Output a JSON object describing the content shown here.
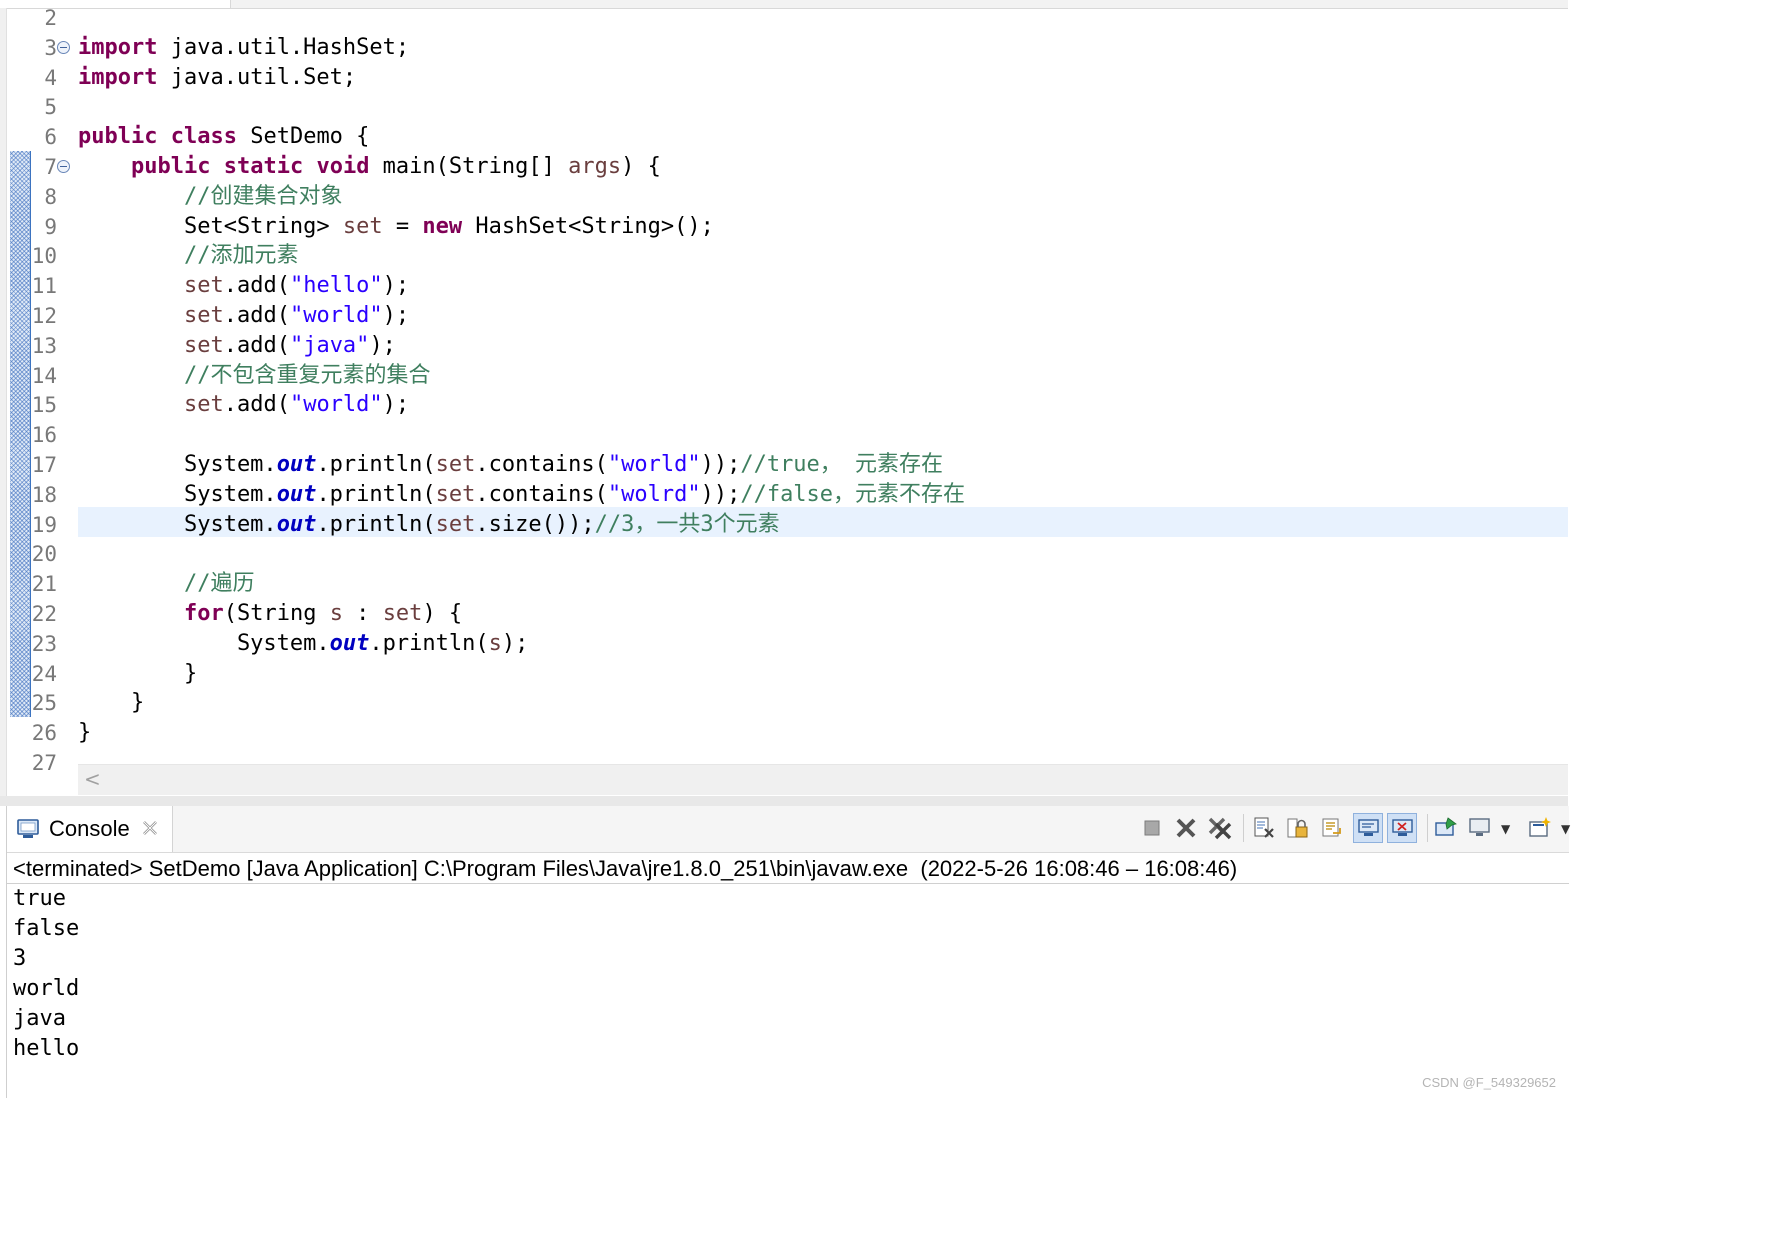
{
  "editor": {
    "current_line": "19",
    "lines": [
      {
        "no": "2",
        "fold": false,
        "tokens": []
      },
      {
        "no": "3",
        "fold": true,
        "tokens": [
          {
            "t": "kw",
            "v": "import"
          },
          {
            "t": "plain",
            "v": " java.util.HashSet;"
          }
        ]
      },
      {
        "no": "4",
        "fold": false,
        "tokens": [
          {
            "t": "kw",
            "v": "import"
          },
          {
            "t": "plain",
            "v": " java.util.Set;"
          }
        ]
      },
      {
        "no": "5",
        "fold": false,
        "tokens": []
      },
      {
        "no": "6",
        "fold": false,
        "tokens": [
          {
            "t": "kw",
            "v": "public"
          },
          {
            "t": "plain",
            "v": " "
          },
          {
            "t": "kw",
            "v": "class"
          },
          {
            "t": "plain",
            "v": " SetDemo {"
          }
        ]
      },
      {
        "no": "7",
        "fold": true,
        "tokens": [
          {
            "t": "plain",
            "v": "    "
          },
          {
            "t": "kw",
            "v": "public"
          },
          {
            "t": "plain",
            "v": " "
          },
          {
            "t": "kw",
            "v": "static"
          },
          {
            "t": "plain",
            "v": " "
          },
          {
            "t": "kw",
            "v": "void"
          },
          {
            "t": "plain",
            "v": " main(String[] "
          },
          {
            "t": "var",
            "v": "args"
          },
          {
            "t": "plain",
            "v": ") {"
          }
        ]
      },
      {
        "no": "8",
        "fold": false,
        "tokens": [
          {
            "t": "plain",
            "v": "        "
          },
          {
            "t": "com",
            "v": "//创建集合对象"
          }
        ]
      },
      {
        "no": "9",
        "fold": false,
        "tokens": [
          {
            "t": "plain",
            "v": "        Set<String> "
          },
          {
            "t": "var",
            "v": "set"
          },
          {
            "t": "plain",
            "v": " = "
          },
          {
            "t": "kw",
            "v": "new"
          },
          {
            "t": "plain",
            "v": " HashSet<String>();"
          }
        ]
      },
      {
        "no": "10",
        "fold": false,
        "tokens": [
          {
            "t": "plain",
            "v": "        "
          },
          {
            "t": "com",
            "v": "//添加元素"
          }
        ]
      },
      {
        "no": "11",
        "fold": false,
        "tokens": [
          {
            "t": "plain",
            "v": "        "
          },
          {
            "t": "var",
            "v": "set"
          },
          {
            "t": "plain",
            "v": ".add("
          },
          {
            "t": "str",
            "v": "\"hello\""
          },
          {
            "t": "plain",
            "v": ");"
          }
        ]
      },
      {
        "no": "12",
        "fold": false,
        "tokens": [
          {
            "t": "plain",
            "v": "        "
          },
          {
            "t": "var",
            "v": "set"
          },
          {
            "t": "plain",
            "v": ".add("
          },
          {
            "t": "str",
            "v": "\"world\""
          },
          {
            "t": "plain",
            "v": ");"
          }
        ]
      },
      {
        "no": "13",
        "fold": false,
        "tokens": [
          {
            "t": "plain",
            "v": "        "
          },
          {
            "t": "var",
            "v": "set"
          },
          {
            "t": "plain",
            "v": ".add("
          },
          {
            "t": "str",
            "v": "\"java\""
          },
          {
            "t": "plain",
            "v": ");"
          }
        ]
      },
      {
        "no": "14",
        "fold": false,
        "tokens": [
          {
            "t": "plain",
            "v": "        "
          },
          {
            "t": "com",
            "v": "//不包含重复元素的集合"
          }
        ]
      },
      {
        "no": "15",
        "fold": false,
        "tokens": [
          {
            "t": "plain",
            "v": "        "
          },
          {
            "t": "var",
            "v": "set"
          },
          {
            "t": "plain",
            "v": ".add("
          },
          {
            "t": "str",
            "v": "\"world\""
          },
          {
            "t": "plain",
            "v": ");"
          }
        ]
      },
      {
        "no": "16",
        "fold": false,
        "tokens": []
      },
      {
        "no": "17",
        "fold": false,
        "tokens": [
          {
            "t": "plain",
            "v": "        System."
          },
          {
            "t": "field",
            "v": "out"
          },
          {
            "t": "plain",
            "v": ".println("
          },
          {
            "t": "var",
            "v": "set"
          },
          {
            "t": "plain",
            "v": ".contains("
          },
          {
            "t": "str",
            "v": "\"world\""
          },
          {
            "t": "plain",
            "v": "));"
          },
          {
            "t": "com",
            "v": "//true， 元素存在"
          }
        ]
      },
      {
        "no": "18",
        "fold": false,
        "tokens": [
          {
            "t": "plain",
            "v": "        System."
          },
          {
            "t": "field",
            "v": "out"
          },
          {
            "t": "plain",
            "v": ".println("
          },
          {
            "t": "var",
            "v": "set"
          },
          {
            "t": "plain",
            "v": ".contains("
          },
          {
            "t": "str",
            "v": "\"wolrd\""
          },
          {
            "t": "plain",
            "v": "));"
          },
          {
            "t": "com",
            "v": "//false，元素不存在"
          }
        ]
      },
      {
        "no": "19",
        "fold": false,
        "tokens": [
          {
            "t": "plain",
            "v": "        System."
          },
          {
            "t": "field",
            "v": "out"
          },
          {
            "t": "plain",
            "v": ".println("
          },
          {
            "t": "var",
            "v": "set"
          },
          {
            "t": "plain",
            "v": ".size());"
          },
          {
            "t": "com",
            "v": "//3，一共3个元素"
          }
        ]
      },
      {
        "no": "20",
        "fold": false,
        "tokens": []
      },
      {
        "no": "21",
        "fold": false,
        "tokens": [
          {
            "t": "plain",
            "v": "        "
          },
          {
            "t": "com",
            "v": "//遍历"
          }
        ]
      },
      {
        "no": "22",
        "fold": false,
        "tokens": [
          {
            "t": "plain",
            "v": "        "
          },
          {
            "t": "kw",
            "v": "for"
          },
          {
            "t": "plain",
            "v": "(String "
          },
          {
            "t": "var",
            "v": "s"
          },
          {
            "t": "plain",
            "v": " : "
          },
          {
            "t": "var",
            "v": "set"
          },
          {
            "t": "plain",
            "v": ") {"
          }
        ]
      },
      {
        "no": "23",
        "fold": false,
        "tokens": [
          {
            "t": "plain",
            "v": "            System."
          },
          {
            "t": "field",
            "v": "out"
          },
          {
            "t": "plain",
            "v": ".println("
          },
          {
            "t": "var",
            "v": "s"
          },
          {
            "t": "plain",
            "v": ");"
          }
        ]
      },
      {
        "no": "24",
        "fold": false,
        "tokens": [
          {
            "t": "plain",
            "v": "        }"
          }
        ]
      },
      {
        "no": "25",
        "fold": false,
        "tokens": [
          {
            "t": "plain",
            "v": "    }"
          }
        ]
      },
      {
        "no": "26",
        "fold": false,
        "tokens": [
          {
            "t": "plain",
            "v": "}"
          }
        ]
      },
      {
        "no": "27",
        "fold": false,
        "tokens": []
      }
    ],
    "scroll_left_glyph": "<"
  },
  "console": {
    "tab_title": "Console",
    "status": "<terminated> SetDemo [Java Application] C:\\Program Files\\Java\\jre1.8.0_251\\bin\\javaw.exe  (2022-5-26 16:08:46 – 16:08:46)",
    "output": [
      "true",
      "false",
      "3",
      "world",
      "java",
      "hello"
    ],
    "toolbar": [
      {
        "name": "terminate-icon",
        "active": false
      },
      {
        "name": "remove-launch-icon",
        "active": false
      },
      {
        "name": "remove-all-terminated-icon",
        "active": false
      },
      {
        "name": "clear-console-icon",
        "active": false
      },
      {
        "name": "scroll-lock-icon",
        "active": false
      },
      {
        "name": "word-wrap-icon",
        "active": false
      },
      {
        "name": "show-console-on-stdout-icon",
        "active": true
      },
      {
        "name": "show-console-on-stderr-icon",
        "active": true
      },
      {
        "name": "pin-console-icon",
        "active": false
      },
      {
        "name": "display-selected-console-icon",
        "active": false
      },
      {
        "name": "open-console-icon",
        "active": false
      }
    ]
  },
  "watermark": "CSDN @F_549329652",
  "colors": {
    "keyword": "#7f0055",
    "string": "#2a00ff",
    "comment": "#3f7f5f",
    "static_field": "#0000c0",
    "local_variable": "#6a3e3e",
    "current_line_bg": "#e8f2fe"
  }
}
